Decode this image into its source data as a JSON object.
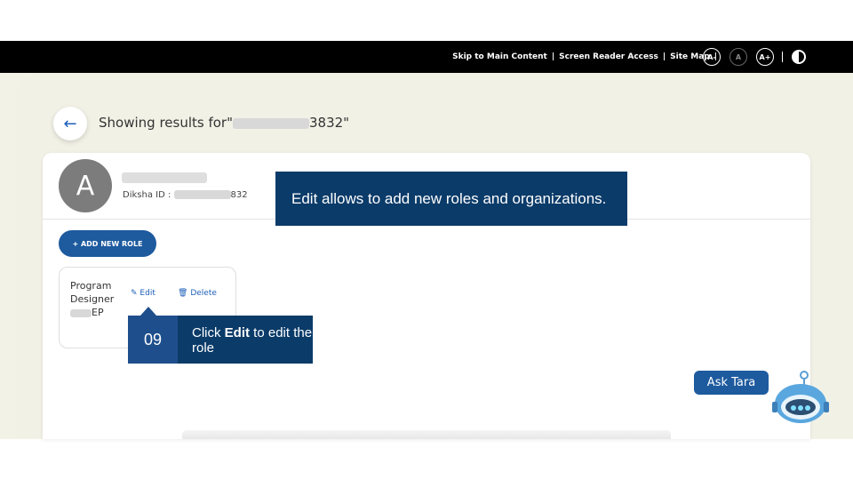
{
  "topbar": {
    "skip": "Skip to Main Content",
    "screen_reader": "Screen Reader Access",
    "sitemap": "Site Map",
    "sep": "|",
    "font_decrease": "A-",
    "font_normal": "A",
    "font_increase": "A+"
  },
  "header": {
    "showing_prefix": "Showing results for\"",
    "showing_suffix": "3832\""
  },
  "user": {
    "avatar_letter": "A",
    "diksha_label": "Diksha ID :",
    "diksha_suffix": "832"
  },
  "actions": {
    "add_role": "+ ADD NEW ROLE"
  },
  "role": {
    "line1": "Program",
    "line2": "Designer",
    "line3": "EP",
    "edit": "Edit",
    "delete": "Delete"
  },
  "tooltip_top": "Edit allows to add new roles and organizations.",
  "callout": {
    "number": "09",
    "text_prefix": "Click ",
    "text_bold": "Edit",
    "text_suffix": " to edit the role"
  },
  "chatbot": {
    "label": "Ask Tara"
  },
  "colors": {
    "accent": "#1d5a9e",
    "tooltip_bg": "#0b3b69",
    "page_bg": "#f3f2e6"
  }
}
